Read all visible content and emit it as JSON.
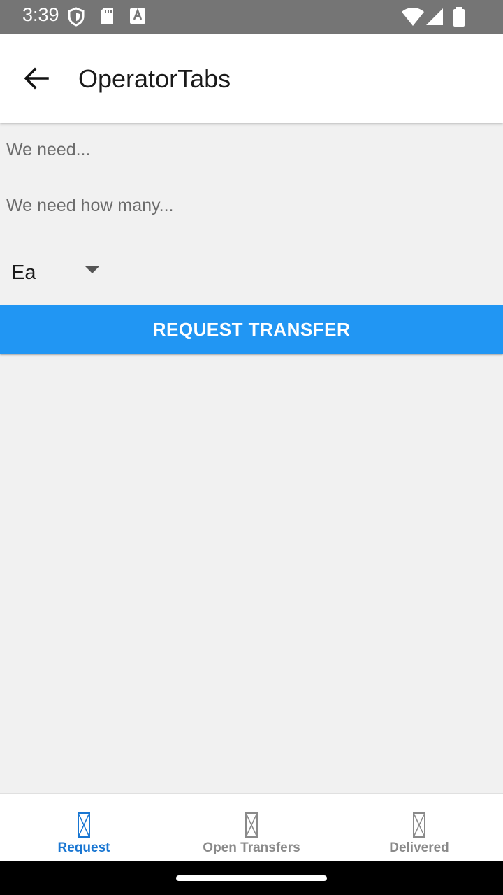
{
  "status_bar": {
    "time": "3:39",
    "icons": [
      "shield-icon",
      "sd-card-icon",
      "font-a-icon",
      "wifi-icon",
      "signal-icon",
      "battery-icon"
    ]
  },
  "app_bar": {
    "back_icon": "arrow-left-icon",
    "title": "OperatorTabs"
  },
  "form": {
    "item_placeholder": "We need...",
    "quantity_placeholder": "We need how many...",
    "unit_selected": "Ea",
    "submit_label": "REQUEST TRANSFER"
  },
  "bottom_nav": {
    "items": [
      {
        "label": "Request",
        "icon": "placeholder-icon",
        "active": true
      },
      {
        "label": "Open Transfers",
        "icon": "placeholder-icon",
        "active": false
      },
      {
        "label": "Delivered",
        "icon": "placeholder-icon",
        "active": false
      }
    ]
  },
  "colors": {
    "accent": "#2196f3",
    "active_tab": "#1976d2",
    "status_bar": "#757575",
    "background": "#f1f1f1"
  }
}
